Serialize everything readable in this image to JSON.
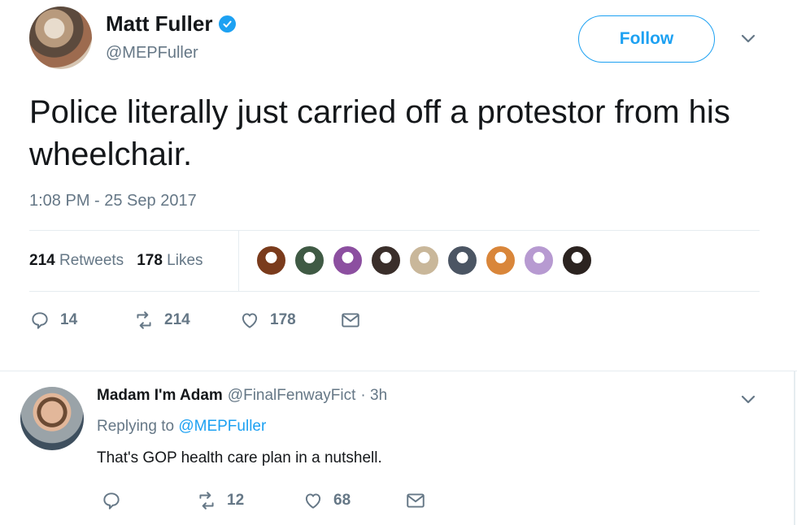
{
  "tweet": {
    "author_name": "Matt Fuller",
    "author_handle": "@MEPFuller",
    "verified": true,
    "follow_label": "Follow",
    "text": "Police literally just carried off a protestor from his wheelchair.",
    "timestamp": "1:08 PM - 25 Sep 2017",
    "retweets_count": "214",
    "retweets_label": "Retweets",
    "likes_count": "178",
    "likes_label": "Likes",
    "liker_avatar_colors": [
      "#7a3b1c",
      "#3f5a44",
      "#8c4fa0",
      "#3a2e2a",
      "#c9b79a",
      "#4b5563",
      "#d9863a",
      "#b79ad1",
      "#2b2320"
    ],
    "actions": {
      "replies": "14",
      "retweets": "214",
      "likes": "178"
    }
  },
  "reply": {
    "author_name": "Madam I'm Adam",
    "author_handle": "@FinalFenwayFict",
    "time": "· 3h",
    "replying_prefix": "Replying to",
    "replying_to": "@MEPFuller",
    "text": "That's GOP health care plan in a nutshell.",
    "actions": {
      "replies": "",
      "retweets": "12",
      "likes": "68"
    }
  },
  "colors": {
    "accent": "#1da1f2",
    "muted": "#657786",
    "border": "#e6ecf0",
    "text": "#14171a"
  }
}
